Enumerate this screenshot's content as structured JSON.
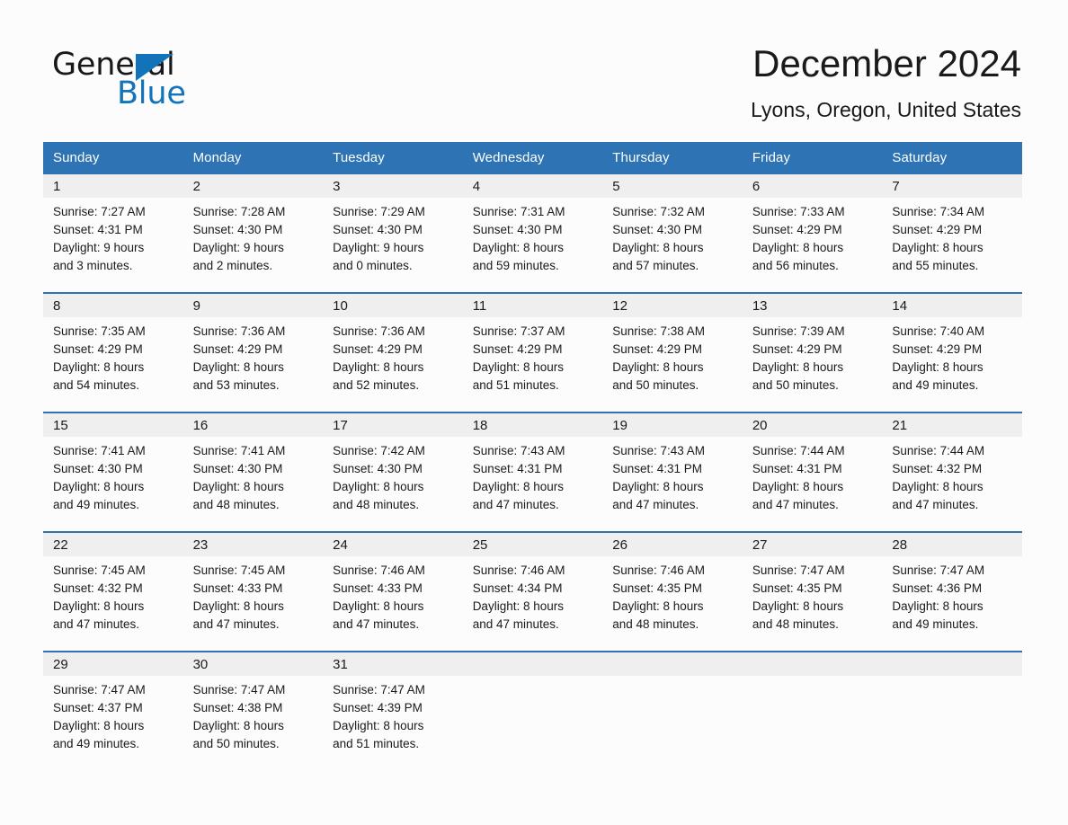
{
  "brand": {
    "name_top": "General",
    "name_bottom": "Blue",
    "triangle_icon": "blue-triangle-icon",
    "accent_color": "#1273bb"
  },
  "header": {
    "title": "December 2024",
    "location": "Lyons, Oregon, United States"
  },
  "theme": {
    "header_blue": "#2e74b5",
    "daynum_band": "#efefef",
    "page_background": "#fcfcfc",
    "text": "#1a1a1a"
  },
  "calendar": {
    "weekdays": [
      "Sunday",
      "Monday",
      "Tuesday",
      "Wednesday",
      "Thursday",
      "Friday",
      "Saturday"
    ],
    "weeks": [
      [
        {
          "day": "1",
          "sunrise": "Sunrise: 7:27 AM",
          "sunset": "Sunset: 4:31 PM",
          "daylight_line1": "Daylight: 9 hours",
          "daylight_line2": "and 3 minutes."
        },
        {
          "day": "2",
          "sunrise": "Sunrise: 7:28 AM",
          "sunset": "Sunset: 4:30 PM",
          "daylight_line1": "Daylight: 9 hours",
          "daylight_line2": "and 2 minutes."
        },
        {
          "day": "3",
          "sunrise": "Sunrise: 7:29 AM",
          "sunset": "Sunset: 4:30 PM",
          "daylight_line1": "Daylight: 9 hours",
          "daylight_line2": "and 0 minutes."
        },
        {
          "day": "4",
          "sunrise": "Sunrise: 7:31 AM",
          "sunset": "Sunset: 4:30 PM",
          "daylight_line1": "Daylight: 8 hours",
          "daylight_line2": "and 59 minutes."
        },
        {
          "day": "5",
          "sunrise": "Sunrise: 7:32 AM",
          "sunset": "Sunset: 4:30 PM",
          "daylight_line1": "Daylight: 8 hours",
          "daylight_line2": "and 57 minutes."
        },
        {
          "day": "6",
          "sunrise": "Sunrise: 7:33 AM",
          "sunset": "Sunset: 4:29 PM",
          "daylight_line1": "Daylight: 8 hours",
          "daylight_line2": "and 56 minutes."
        },
        {
          "day": "7",
          "sunrise": "Sunrise: 7:34 AM",
          "sunset": "Sunset: 4:29 PM",
          "daylight_line1": "Daylight: 8 hours",
          "daylight_line2": "and 55 minutes."
        }
      ],
      [
        {
          "day": "8",
          "sunrise": "Sunrise: 7:35 AM",
          "sunset": "Sunset: 4:29 PM",
          "daylight_line1": "Daylight: 8 hours",
          "daylight_line2": "and 54 minutes."
        },
        {
          "day": "9",
          "sunrise": "Sunrise: 7:36 AM",
          "sunset": "Sunset: 4:29 PM",
          "daylight_line1": "Daylight: 8 hours",
          "daylight_line2": "and 53 minutes."
        },
        {
          "day": "10",
          "sunrise": "Sunrise: 7:36 AM",
          "sunset": "Sunset: 4:29 PM",
          "daylight_line1": "Daylight: 8 hours",
          "daylight_line2": "and 52 minutes."
        },
        {
          "day": "11",
          "sunrise": "Sunrise: 7:37 AM",
          "sunset": "Sunset: 4:29 PM",
          "daylight_line1": "Daylight: 8 hours",
          "daylight_line2": "and 51 minutes."
        },
        {
          "day": "12",
          "sunrise": "Sunrise: 7:38 AM",
          "sunset": "Sunset: 4:29 PM",
          "daylight_line1": "Daylight: 8 hours",
          "daylight_line2": "and 50 minutes."
        },
        {
          "day": "13",
          "sunrise": "Sunrise: 7:39 AM",
          "sunset": "Sunset: 4:29 PM",
          "daylight_line1": "Daylight: 8 hours",
          "daylight_line2": "and 50 minutes."
        },
        {
          "day": "14",
          "sunrise": "Sunrise: 7:40 AM",
          "sunset": "Sunset: 4:29 PM",
          "daylight_line1": "Daylight: 8 hours",
          "daylight_line2": "and 49 minutes."
        }
      ],
      [
        {
          "day": "15",
          "sunrise": "Sunrise: 7:41 AM",
          "sunset": "Sunset: 4:30 PM",
          "daylight_line1": "Daylight: 8 hours",
          "daylight_line2": "and 49 minutes."
        },
        {
          "day": "16",
          "sunrise": "Sunrise: 7:41 AM",
          "sunset": "Sunset: 4:30 PM",
          "daylight_line1": "Daylight: 8 hours",
          "daylight_line2": "and 48 minutes."
        },
        {
          "day": "17",
          "sunrise": "Sunrise: 7:42 AM",
          "sunset": "Sunset: 4:30 PM",
          "daylight_line1": "Daylight: 8 hours",
          "daylight_line2": "and 48 minutes."
        },
        {
          "day": "18",
          "sunrise": "Sunrise: 7:43 AM",
          "sunset": "Sunset: 4:31 PM",
          "daylight_line1": "Daylight: 8 hours",
          "daylight_line2": "and 47 minutes."
        },
        {
          "day": "19",
          "sunrise": "Sunrise: 7:43 AM",
          "sunset": "Sunset: 4:31 PM",
          "daylight_line1": "Daylight: 8 hours",
          "daylight_line2": "and 47 minutes."
        },
        {
          "day": "20",
          "sunrise": "Sunrise: 7:44 AM",
          "sunset": "Sunset: 4:31 PM",
          "daylight_line1": "Daylight: 8 hours",
          "daylight_line2": "and 47 minutes."
        },
        {
          "day": "21",
          "sunrise": "Sunrise: 7:44 AM",
          "sunset": "Sunset: 4:32 PM",
          "daylight_line1": "Daylight: 8 hours",
          "daylight_line2": "and 47 minutes."
        }
      ],
      [
        {
          "day": "22",
          "sunrise": "Sunrise: 7:45 AM",
          "sunset": "Sunset: 4:32 PM",
          "daylight_line1": "Daylight: 8 hours",
          "daylight_line2": "and 47 minutes."
        },
        {
          "day": "23",
          "sunrise": "Sunrise: 7:45 AM",
          "sunset": "Sunset: 4:33 PM",
          "daylight_line1": "Daylight: 8 hours",
          "daylight_line2": "and 47 minutes."
        },
        {
          "day": "24",
          "sunrise": "Sunrise: 7:46 AM",
          "sunset": "Sunset: 4:33 PM",
          "daylight_line1": "Daylight: 8 hours",
          "daylight_line2": "and 47 minutes."
        },
        {
          "day": "25",
          "sunrise": "Sunrise: 7:46 AM",
          "sunset": "Sunset: 4:34 PM",
          "daylight_line1": "Daylight: 8 hours",
          "daylight_line2": "and 47 minutes."
        },
        {
          "day": "26",
          "sunrise": "Sunrise: 7:46 AM",
          "sunset": "Sunset: 4:35 PM",
          "daylight_line1": "Daylight: 8 hours",
          "daylight_line2": "and 48 minutes."
        },
        {
          "day": "27",
          "sunrise": "Sunrise: 7:47 AM",
          "sunset": "Sunset: 4:35 PM",
          "daylight_line1": "Daylight: 8 hours",
          "daylight_line2": "and 48 minutes."
        },
        {
          "day": "28",
          "sunrise": "Sunrise: 7:47 AM",
          "sunset": "Sunset: 4:36 PM",
          "daylight_line1": "Daylight: 8 hours",
          "daylight_line2": "and 49 minutes."
        }
      ],
      [
        {
          "day": "29",
          "sunrise": "Sunrise: 7:47 AM",
          "sunset": "Sunset: 4:37 PM",
          "daylight_line1": "Daylight: 8 hours",
          "daylight_line2": "and 49 minutes."
        },
        {
          "day": "30",
          "sunrise": "Sunrise: 7:47 AM",
          "sunset": "Sunset: 4:38 PM",
          "daylight_line1": "Daylight: 8 hours",
          "daylight_line2": "and 50 minutes."
        },
        {
          "day": "31",
          "sunrise": "Sunrise: 7:47 AM",
          "sunset": "Sunset: 4:39 PM",
          "daylight_line1": "Daylight: 8 hours",
          "daylight_line2": "and 51 minutes."
        },
        {
          "day": "",
          "sunrise": "",
          "sunset": "",
          "daylight_line1": "",
          "daylight_line2": ""
        },
        {
          "day": "",
          "sunrise": "",
          "sunset": "",
          "daylight_line1": "",
          "daylight_line2": ""
        },
        {
          "day": "",
          "sunrise": "",
          "sunset": "",
          "daylight_line1": "",
          "daylight_line2": ""
        },
        {
          "day": "",
          "sunrise": "",
          "sunset": "",
          "daylight_line1": "",
          "daylight_line2": ""
        }
      ]
    ]
  }
}
